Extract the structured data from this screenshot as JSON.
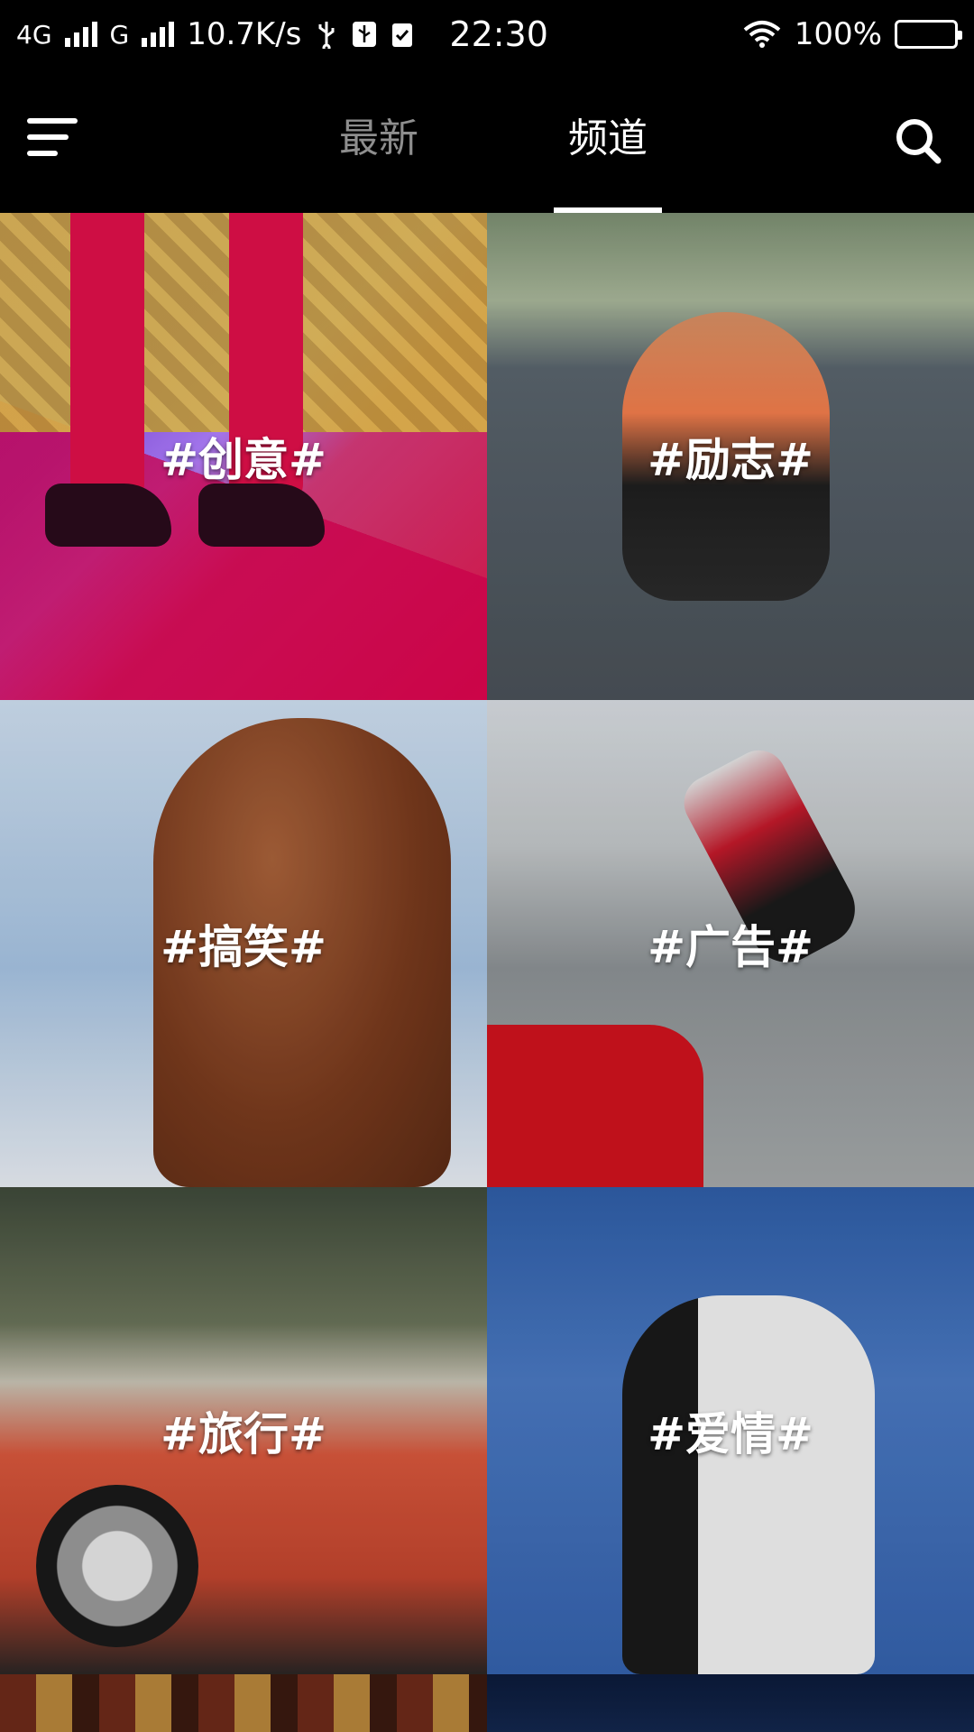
{
  "status_bar": {
    "network_1": "4G",
    "network_2": "G",
    "speed": "10.7K/s",
    "time": "22:30",
    "battery": "100%",
    "icons": [
      "signal-icon",
      "usb-icon",
      "usb-debug-icon",
      "clipboard-check-icon",
      "wifi-icon",
      "battery-icon"
    ]
  },
  "header": {
    "menu_icon": "menu-icon",
    "tabs": [
      {
        "label": "最新",
        "active": false
      },
      {
        "label": "频道",
        "active": true
      }
    ],
    "search_icon": "search-icon",
    "active_color": "#ffffff",
    "inactive_color": "#8e8e8e"
  },
  "channels": [
    {
      "label": "#创意#"
    },
    {
      "label": "#励志#"
    },
    {
      "label": "#搞笑#"
    },
    {
      "label": "#广告#"
    },
    {
      "label": "#旅行#"
    },
    {
      "label": "#爱情#"
    }
  ]
}
